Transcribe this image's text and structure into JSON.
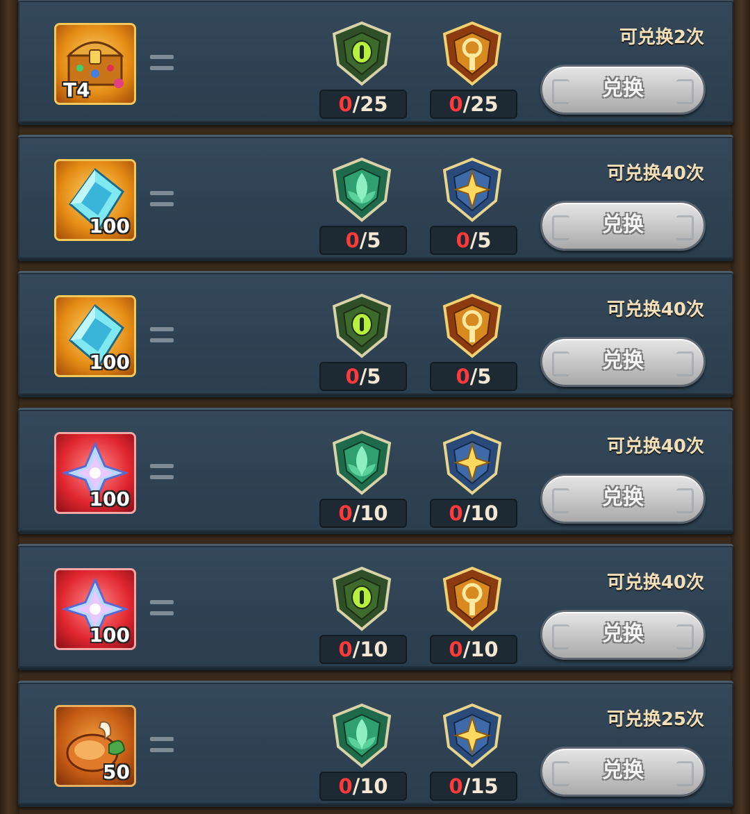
{
  "exchange_label": "兑换",
  "rows": [
    {
      "reward": {
        "name": "t4-treasure-chest",
        "quantity": "T4",
        "style": "gold"
      },
      "token1": {
        "name": "green-eye-emblem-icon",
        "have": "0",
        "need": "/25"
      },
      "token2": {
        "name": "gold-emblem-icon",
        "have": "0",
        "need": "/25"
      },
      "limit": "可兑换2次"
    },
    {
      "reward": {
        "name": "diamond-crystal",
        "quantity": "100",
        "style": "gold"
      },
      "token1": {
        "name": "green-leaf-emblem-icon",
        "have": "0",
        "need": "/5"
      },
      "token2": {
        "name": "blue-star-emblem-icon",
        "have": "0",
        "need": "/5"
      },
      "limit": "可兑换40次"
    },
    {
      "reward": {
        "name": "diamond-crystal",
        "quantity": "100",
        "style": "gold"
      },
      "token1": {
        "name": "green-eye-emblem-icon",
        "have": "0",
        "need": "/5"
      },
      "token2": {
        "name": "gold-emblem-icon",
        "have": "0",
        "need": "/5"
      },
      "limit": "可兑换40次"
    },
    {
      "reward": {
        "name": "crystal-flower-shard",
        "quantity": "100",
        "style": "red"
      },
      "token1": {
        "name": "green-leaf-emblem-icon",
        "have": "0",
        "need": "/10"
      },
      "token2": {
        "name": "blue-star-emblem-icon",
        "have": "0",
        "need": "/10"
      },
      "limit": "可兑换40次"
    },
    {
      "reward": {
        "name": "crystal-flower-shard",
        "quantity": "100",
        "style": "red"
      },
      "token1": {
        "name": "green-eye-emblem-icon",
        "have": "0",
        "need": "/10"
      },
      "token2": {
        "name": "gold-emblem-icon",
        "have": "0",
        "need": "/10"
      },
      "limit": "可兑换40次"
    },
    {
      "reward": {
        "name": "meat-food",
        "quantity": "50",
        "style": "orange"
      },
      "token1": {
        "name": "green-leaf-emblem-icon",
        "have": "0",
        "need": "/10"
      },
      "token2": {
        "name": "blue-star-emblem-icon",
        "have": "0",
        "need": "/15"
      },
      "limit": "可兑换25次"
    }
  ]
}
